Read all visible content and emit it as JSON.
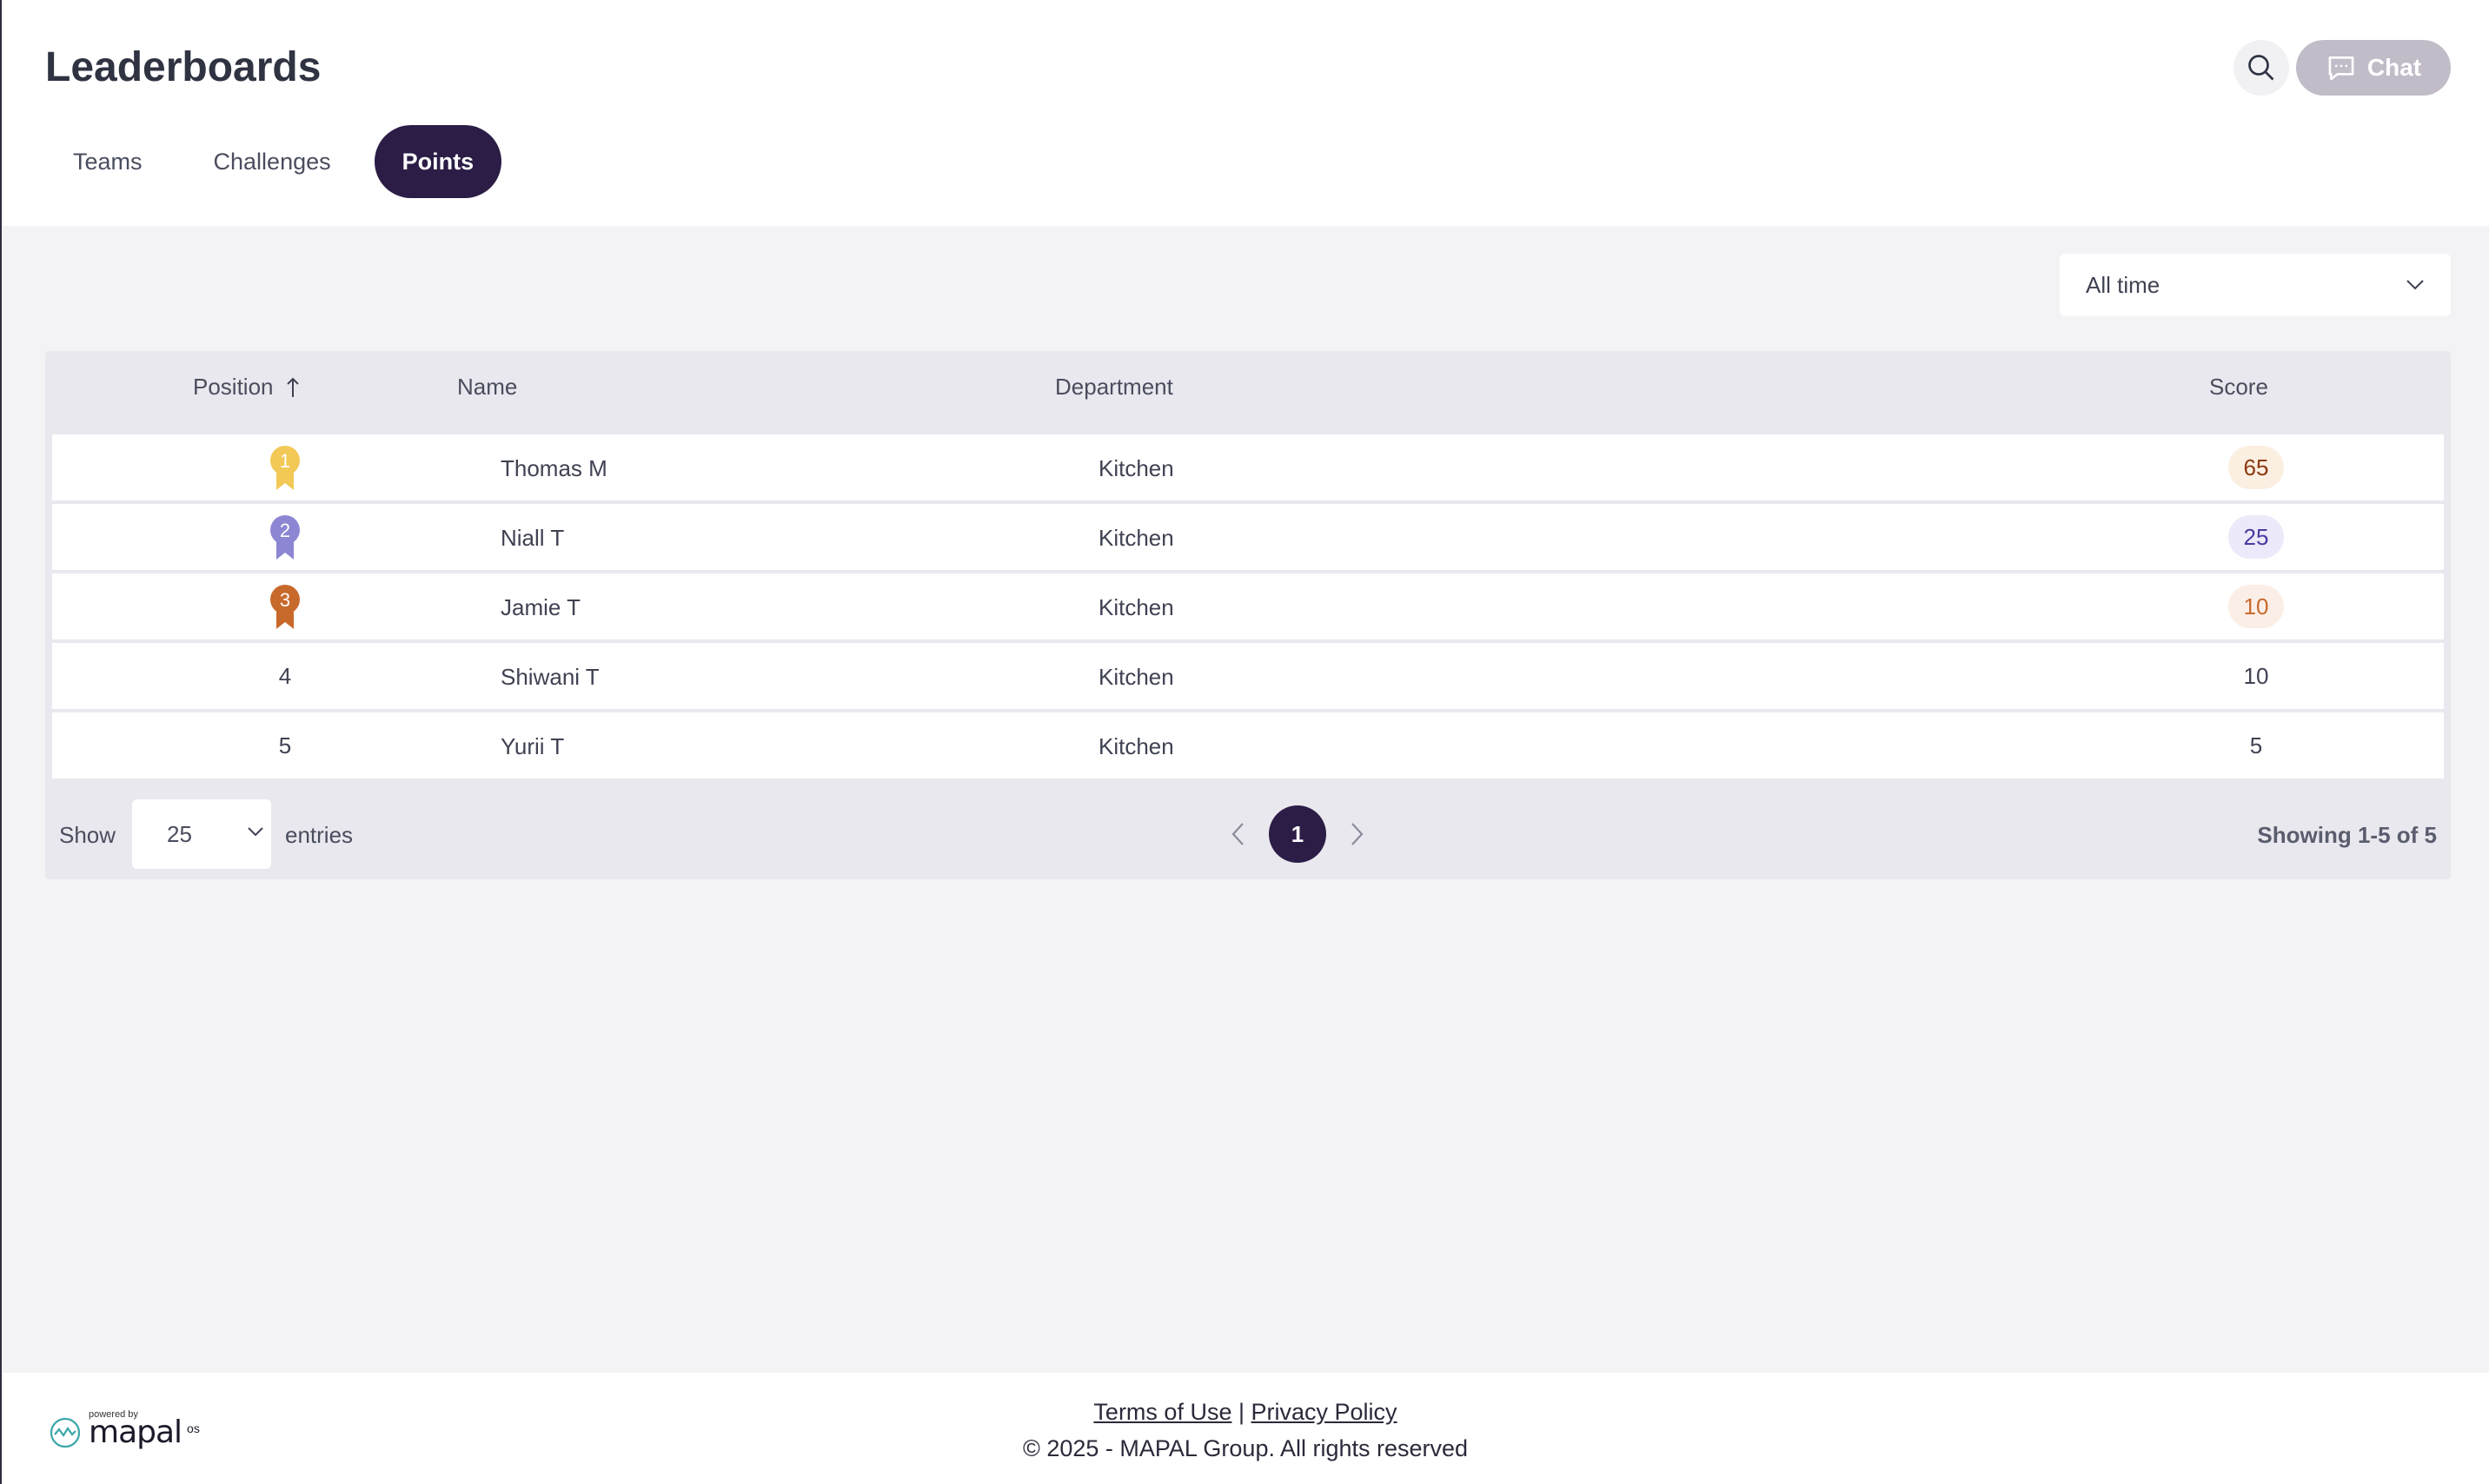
{
  "page": {
    "title": "Leaderboards"
  },
  "header": {
    "chat_label": "Chat"
  },
  "tabs": [
    {
      "label": "Teams",
      "active": false
    },
    {
      "label": "Challenges",
      "active": false
    },
    {
      "label": "Points",
      "active": true
    }
  ],
  "filter": {
    "selected": "All time"
  },
  "table": {
    "columns": {
      "position": "Position",
      "name": "Name",
      "department": "Department",
      "score": "Score"
    },
    "rows": [
      {
        "position": "1",
        "name": "Thomas M",
        "department": "Kitchen",
        "score": "65"
      },
      {
        "position": "2",
        "name": "Niall T",
        "department": "Kitchen",
        "score": "25"
      },
      {
        "position": "3",
        "name": "Jamie T",
        "department": "Kitchen",
        "score": "10"
      },
      {
        "position": "4",
        "name": "Shiwani T",
        "department": "Kitchen",
        "score": "10"
      },
      {
        "position": "5",
        "name": "Yurii T",
        "department": "Kitchen",
        "score": "5"
      }
    ]
  },
  "pagination": {
    "show_label": "Show",
    "entries_value": "25",
    "entries_label": "entries",
    "current_page": "1",
    "showing": "Showing 1-5 of 5"
  },
  "footer": {
    "terms": "Terms of Use",
    "separator": "|",
    "privacy": "Privacy Policy",
    "copyright": "© 2025 - MAPAL Group. All rights reserved",
    "powered_by": "powered by",
    "brand": "mapal",
    "brand_suffix": "os"
  },
  "colors": {
    "accent": "#2b1d46",
    "gold_medal": "#f2c857",
    "silver_medal": "#8d86d3",
    "bronze_medal": "#c8692c",
    "gold_pill_bg": "#fbefe1",
    "gold_pill_text": "#8a3a12",
    "silver_pill_bg": "#ece9fa",
    "silver_pill_text": "#4b3aa0",
    "bronze_pill_bg": "#fbeee6",
    "bronze_pill_text": "#c8692c"
  }
}
